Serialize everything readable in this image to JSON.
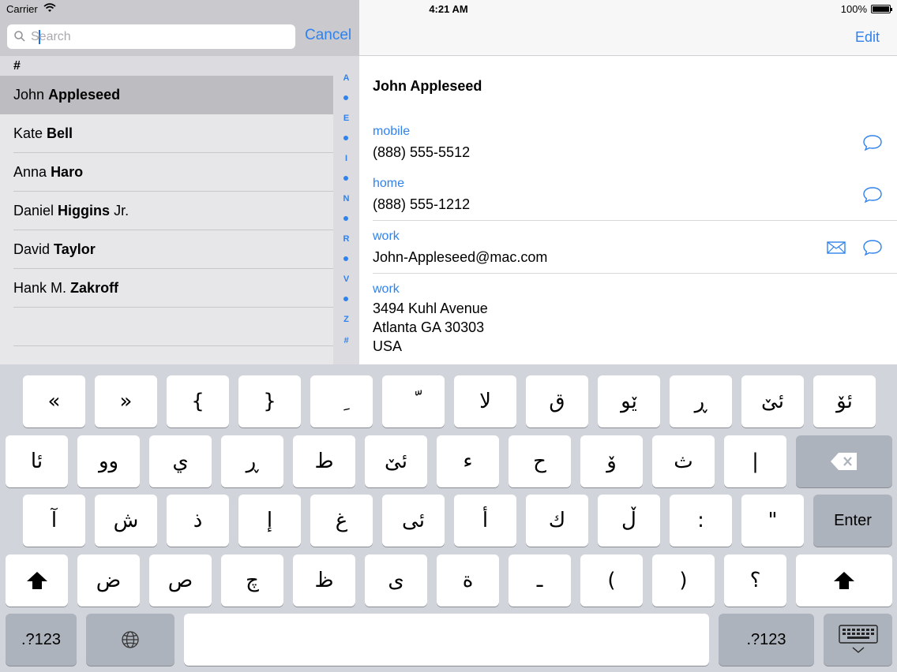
{
  "status_bar": {
    "carrier": "Carrier",
    "time": "4:21 AM",
    "battery": "100%"
  },
  "search": {
    "placeholder": "Search",
    "cancel_label": "Cancel"
  },
  "contacts": {
    "section": "#",
    "items": [
      {
        "first": "John",
        "last": "Appleseed",
        "suffix": "",
        "selected": true
      },
      {
        "first": "Kate",
        "last": "Bell",
        "suffix": "",
        "selected": false
      },
      {
        "first": "Anna",
        "last": "Haro",
        "suffix": "",
        "selected": false
      },
      {
        "first": "Daniel",
        "last": "Higgins",
        "suffix": "Jr.",
        "selected": false
      },
      {
        "first": "David",
        "last": "Taylor",
        "suffix": "",
        "selected": false
      },
      {
        "first": "Hank M.",
        "last": "Zakroff",
        "suffix": "",
        "selected": false
      }
    ]
  },
  "index_bar": [
    "A",
    "•",
    "E",
    "•",
    "I",
    "•",
    "N",
    "•",
    "R",
    "•",
    "V",
    "•",
    "Z",
    "#"
  ],
  "detail": {
    "edit_label": "Edit",
    "name": "John Appleseed",
    "fields": [
      {
        "label": "mobile",
        "value": "(888) 555-5512"
      },
      {
        "label": "home",
        "value": "(888) 555-1212"
      },
      {
        "label": "work",
        "value": "John-Appleseed@mac.com"
      },
      {
        "label": "work",
        "value_lines": [
          "3494 Kuhl Avenue",
          "Atlanta GA 30303",
          "USA"
        ]
      }
    ]
  },
  "keyboard": {
    "row1": [
      "«",
      "»",
      "{",
      "}",
      "ِ",
      "ّ",
      "لا",
      "ق",
      "ێو",
      "ڕ",
      "ئێ",
      "ئۆ"
    ],
    "row2": [
      "ئا",
      "وو",
      "ي",
      "ڕ",
      "ط",
      "ئێ",
      "ء",
      "ح",
      "ۆ",
      "ث",
      "|"
    ],
    "row3": [
      "آ",
      "ش",
      "ذ",
      "إ",
      "غ",
      "ئی",
      "أ",
      "ك",
      "ڵ",
      ":",
      "\""
    ],
    "enter_label": "Enter",
    "row4": [
      "ض",
      "ص",
      "چ",
      "ظ",
      "ى",
      "ة",
      "ـ",
      "(",
      ")",
      "؟"
    ],
    "numbers_label": ".?123",
    "numbers_label_right": ".?123"
  }
}
